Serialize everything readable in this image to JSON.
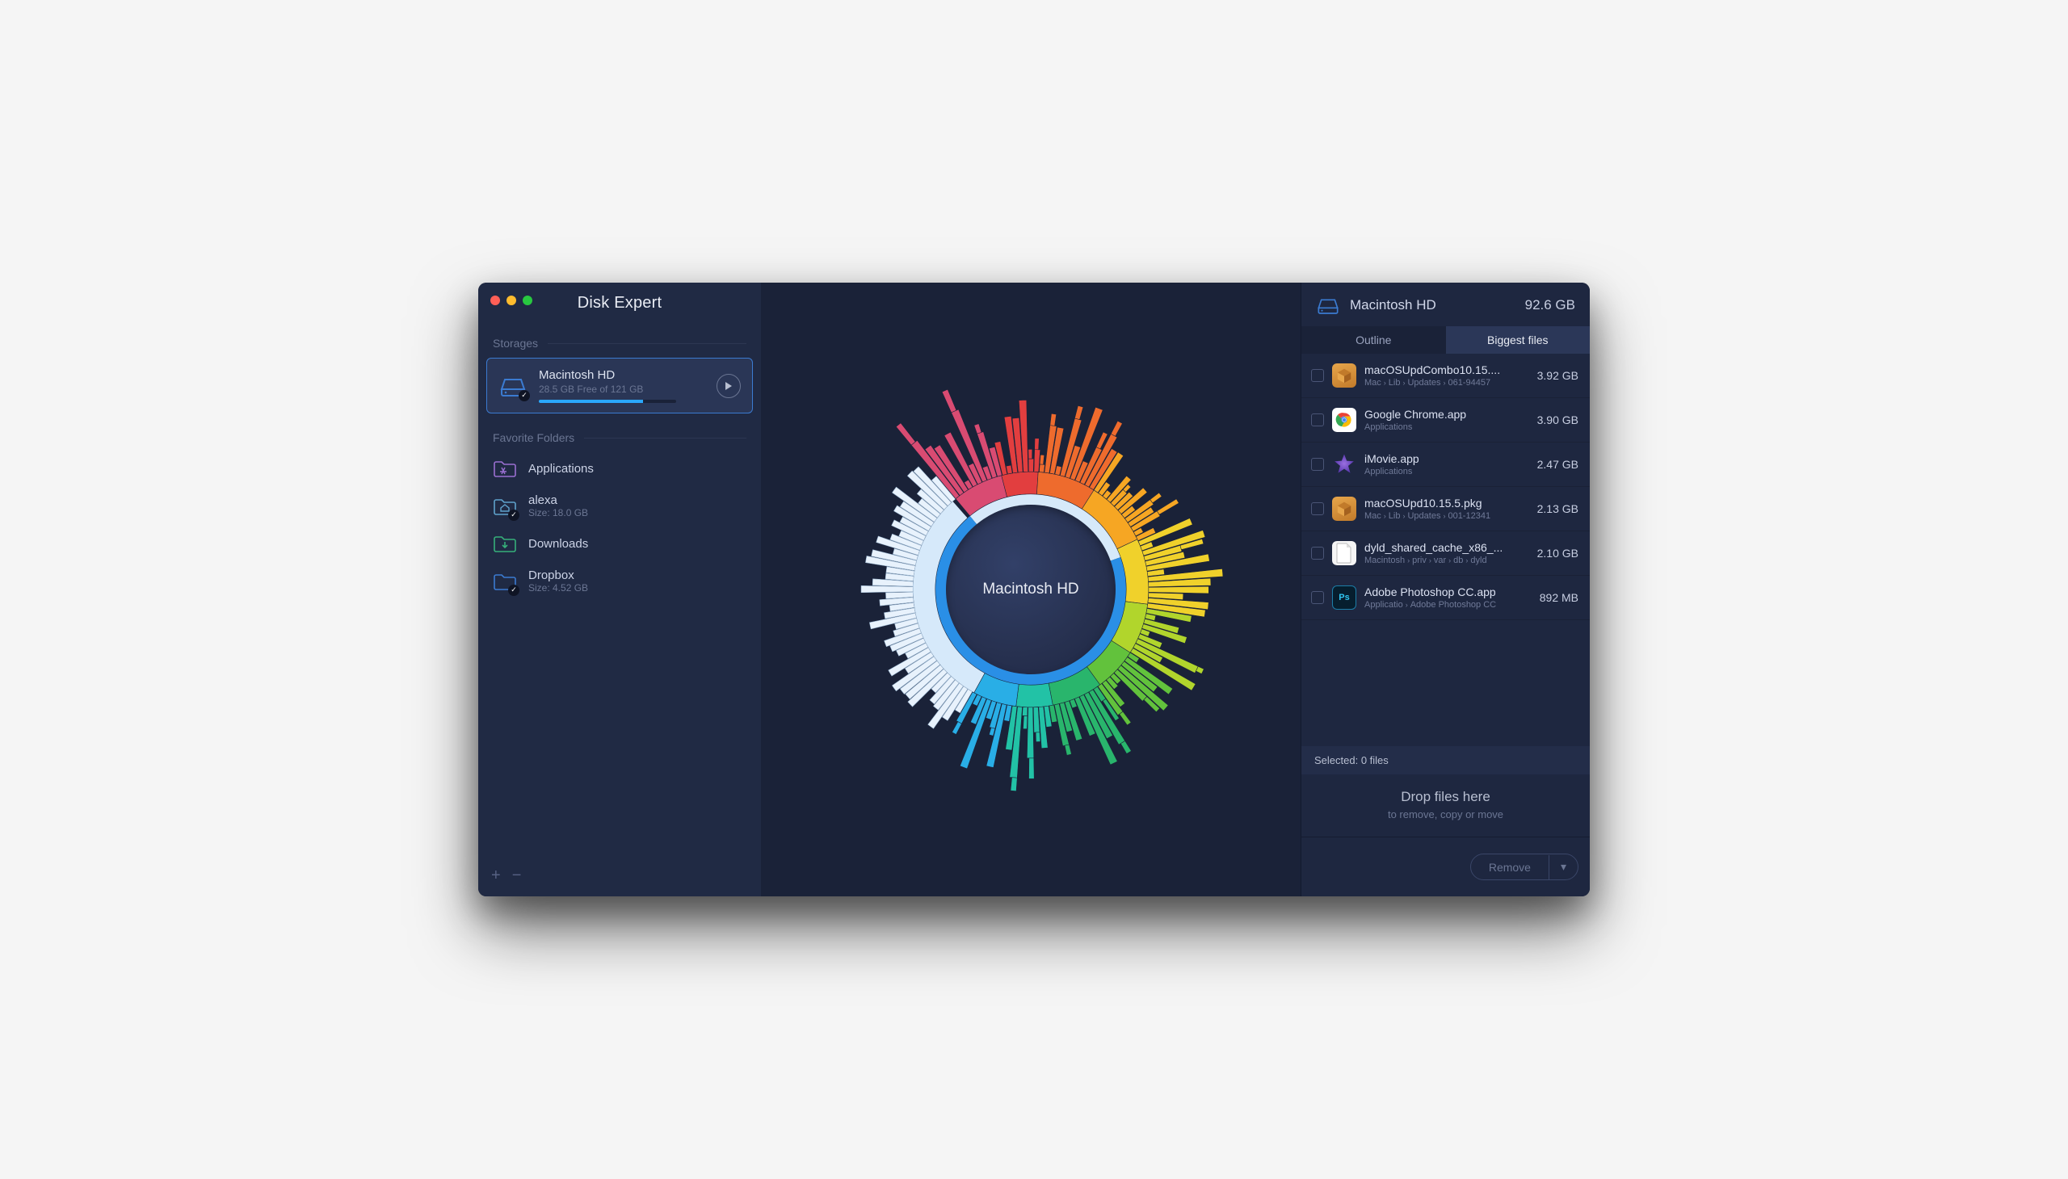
{
  "app": {
    "title": "Disk Expert"
  },
  "sidebar": {
    "sections": {
      "storages": "Storages",
      "favorites": "Favorite Folders"
    },
    "storage": {
      "name": "Macintosh HD",
      "subtitle": "28.5 GB Free of 121 GB",
      "used_fraction": 0.764
    },
    "favorites": [
      {
        "label": "Applications",
        "sub": "",
        "icon": "apps",
        "color": "#9a6fd1",
        "badge": false
      },
      {
        "label": "alexa",
        "sub": "Size: 18.0 GB",
        "icon": "home",
        "color": "#5fa2cc",
        "badge": true
      },
      {
        "label": "Downloads",
        "sub": "",
        "icon": "download",
        "color": "#36b07a",
        "badge": false
      },
      {
        "label": "Dropbox",
        "sub": "Size: 4.52 GB",
        "icon": "folder",
        "color": "#3b7bd1",
        "badge": true
      }
    ]
  },
  "center": {
    "label": "Macintosh HD"
  },
  "panel": {
    "disk_name": "Macintosh HD",
    "disk_size": "92.6 GB",
    "tabs": {
      "outline": "Outline",
      "biggest": "Biggest files"
    },
    "active_tab": "biggest",
    "files": [
      {
        "name": "macOSUpdCombo10.15....",
        "size": "3.92 GB",
        "path": [
          "Mac",
          "Lib",
          "Updates",
          "061-94457"
        ],
        "icon": "box"
      },
      {
        "name": "Google Chrome.app",
        "size": "3.90 GB",
        "path": [
          "Applications"
        ],
        "icon": "chrome"
      },
      {
        "name": "iMovie.app",
        "size": "2.47 GB",
        "path": [
          "Applications"
        ],
        "icon": "star"
      },
      {
        "name": "macOSUpd10.15.5.pkg",
        "size": "2.13 GB",
        "path": [
          "Mac",
          "Lib",
          "Updates",
          "001-12341"
        ],
        "icon": "box"
      },
      {
        "name": "dyld_shared_cache_x86_...",
        "size": "2.10 GB",
        "path": [
          "Macintosh",
          "priv",
          "var",
          "db",
          "dyld"
        ],
        "icon": "doc"
      },
      {
        "name": "Adobe Photoshop CC.app",
        "size": "892 MB",
        "path": [
          "Applicatio",
          "Adobe Photoshop CC"
        ],
        "icon": "ps"
      }
    ],
    "selected_label": "Selected: 0 files",
    "drop_title": "Drop files here",
    "drop_sub": "to remove, copy or move",
    "remove_label": "Remove"
  },
  "chart_data": {
    "type": "sunburst",
    "center_label": "Macintosh HD",
    "note": "Inner ring segments and outer spikes estimated from pixel proportions; colors are category markers, not explicit legend entries in the UI.",
    "rings": [
      {
        "level": 1,
        "segments": [
          {
            "color": "#d6e9fa",
            "fraction": 0.305,
            "label_hint": "free"
          },
          {
            "color": "#2a8fe6",
            "fraction": 0.695,
            "label_hint": "used"
          }
        ]
      },
      {
        "level": 2,
        "segments": [
          {
            "color": "#d94b72",
            "fraction": 0.07
          },
          {
            "color": "#e23e3f",
            "fraction": 0.05
          },
          {
            "color": "#ee6b2d",
            "fraction": 0.08
          },
          {
            "color": "#f6a623",
            "fraction": 0.09
          },
          {
            "color": "#f0d12b",
            "fraction": 0.09
          },
          {
            "color": "#b1d52c",
            "fraction": 0.07
          },
          {
            "color": "#62c23c",
            "fraction": 0.06
          },
          {
            "color": "#29b56c",
            "fraction": 0.07
          },
          {
            "color": "#22c2a6",
            "fraction": 0.05
          },
          {
            "color": "#29aee6",
            "fraction": 0.06
          },
          {
            "color": "#d6e9fa",
            "fraction": 0.305
          }
        ]
      }
    ],
    "outer_spikes": {
      "description": "Variable-height radial bars representing folder tree depth/size",
      "approx_count": 120,
      "max_relative_height": 1.0,
      "min_relative_height": 0.05
    }
  }
}
